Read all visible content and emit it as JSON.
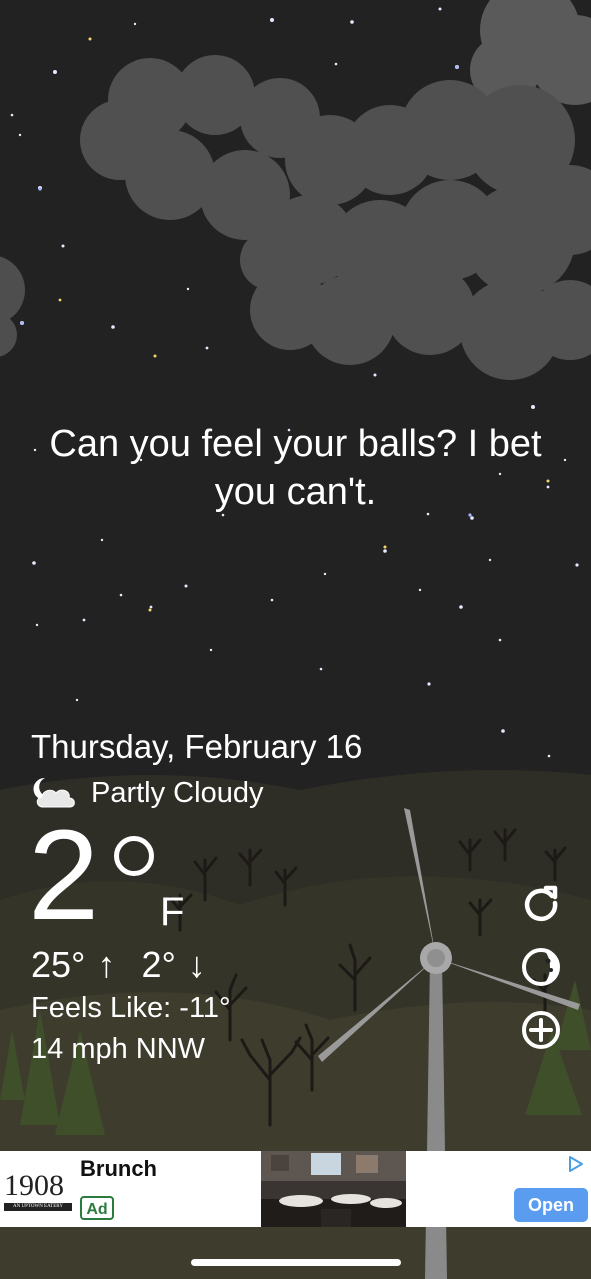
{
  "background": {
    "sky_color": "#222222",
    "ground_color": "#3b3a2c"
  },
  "headline": {
    "line1": "Can you feel your balls? I bet",
    "line2": "you can't."
  },
  "weather": {
    "date": "Thursday, February 16",
    "condition": "Partly Cloudy",
    "condition_icon": "partly-cloudy-night-icon",
    "temperature": "2",
    "unit": "F",
    "high": "25°",
    "high_arrow": "↑",
    "low": "2°",
    "low_arrow": "↓",
    "feels_like": "Feels Like: -11°",
    "wind": "14 mph NNW"
  },
  "actions": [
    {
      "name": "refresh-icon"
    },
    {
      "name": "theme-icon"
    },
    {
      "name": "add-icon"
    }
  ],
  "ad": {
    "logo_number": "1908",
    "logo_tagline": "AN UPTOWN EATERY",
    "title": "Brunch",
    "badge": "Ad",
    "open_label": "Open",
    "open_color": "#5a9cf0",
    "choices_icon": "ad-choices-icon"
  }
}
